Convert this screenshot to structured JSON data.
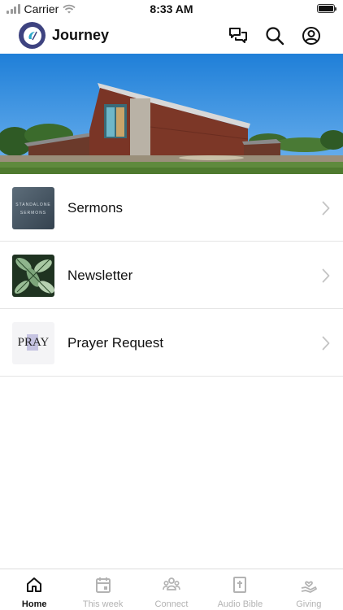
{
  "status_bar": {
    "carrier": "Carrier",
    "time": "8:33 AM"
  },
  "header": {
    "title": "Journey",
    "icons": [
      "chat-icon",
      "search-icon",
      "account-icon"
    ]
  },
  "hero": {
    "image": "church-building-photo"
  },
  "menu": {
    "items": [
      {
        "label": "Sermons",
        "thumb_line1": "STANDALONE",
        "thumb_line2": "SERMONS"
      },
      {
        "label": "Newsletter"
      },
      {
        "label": "Prayer Request",
        "thumb_text": "PRAY"
      }
    ]
  },
  "tabs": [
    {
      "label": "Home",
      "icon": "home-icon",
      "active": true
    },
    {
      "label": "This week",
      "icon": "calendar-icon",
      "active": false
    },
    {
      "label": "Connect",
      "icon": "group-icon",
      "active": false
    },
    {
      "label": "Audio Bible",
      "icon": "bible-icon",
      "active": false
    },
    {
      "label": "Giving",
      "icon": "giving-icon",
      "active": false
    }
  ],
  "colors": {
    "logo": "#3e4380",
    "accent_text": "#111111",
    "inactive_tab": "#b3b3b3"
  }
}
